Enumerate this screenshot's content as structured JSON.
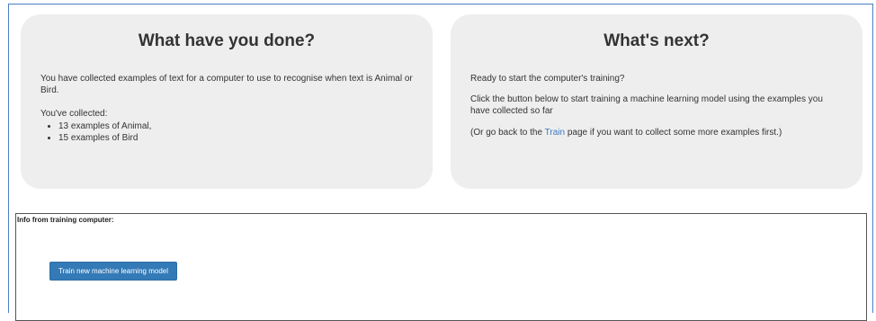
{
  "left_card": {
    "title": "What have you done?",
    "intro": "You have collected examples of text for a computer to use to recognise when text is Animal or Bird.",
    "collected_label": "You've collected:",
    "items": [
      "13 examples of Animal,",
      "15 examples of Bird"
    ]
  },
  "right_card": {
    "title": "What's next?",
    "line1": "Ready to start the computer's training?",
    "line2": "Click the button below to start training a machine learning model using the examples you have collected so far",
    "line3_before": "(Or go back to the ",
    "line3_link": "Train",
    "line3_after": " page if you want to collect some more examples first.)"
  },
  "info": {
    "label": "Info from training computer:",
    "button_label": "Train new machine learning model"
  },
  "colors": {
    "card_bg": "#eeeeee",
    "button_bg": "#337ab7",
    "link": "#3b7bbf"
  }
}
